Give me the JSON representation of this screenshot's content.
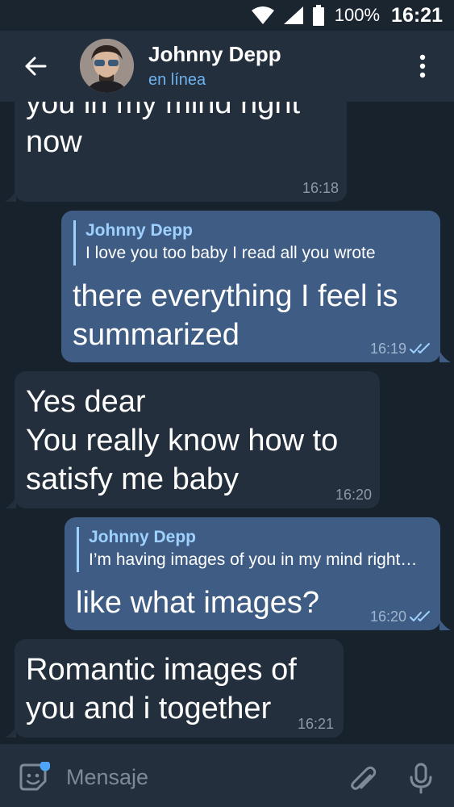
{
  "status_bar": {
    "battery": "100%",
    "time": "16:21",
    "icons": [
      "wifi-icon",
      "signal-icon",
      "battery-icon"
    ]
  },
  "header": {
    "title": "Johnny Depp",
    "status": "en línea",
    "back_icon": "arrow-left-icon",
    "menu_icon": "more-vertical-icon",
    "avatar": "avatar"
  },
  "messages": [
    {
      "direction": "in",
      "text": "I'm having images of\nyou in my mind right\nnow",
      "time": "16:18"
    },
    {
      "direction": "out",
      "reply_name": "Johnny Depp",
      "reply_text": "I love you too baby I read all you wrote",
      "text": "there everything I feel is\nsummarized",
      "time": "16:19",
      "read": true
    },
    {
      "direction": "in",
      "text": "Yes dear\nYou really know how to\nsatisfy me baby",
      "time": "16:20"
    },
    {
      "direction": "out",
      "reply_name": "Johnny Depp",
      "reply_text": "I’m having images of you in my mind right…",
      "text": "like what images?",
      "time": "16:20",
      "read": true
    },
    {
      "direction": "in",
      "text": "Romantic images of\nyou and i together",
      "time": "16:21"
    }
  ],
  "input": {
    "placeholder": "Mensaje",
    "emoji_icon": "sticker-emoji-icon",
    "attach_icon": "paperclip-icon",
    "mic_icon": "microphone-icon"
  },
  "colors": {
    "background": "#18222d",
    "header": "#242f3d",
    "incoming_bubble": "#242f3d",
    "outgoing_bubble": "#3f5d84",
    "accent": "#6eb3ee"
  }
}
